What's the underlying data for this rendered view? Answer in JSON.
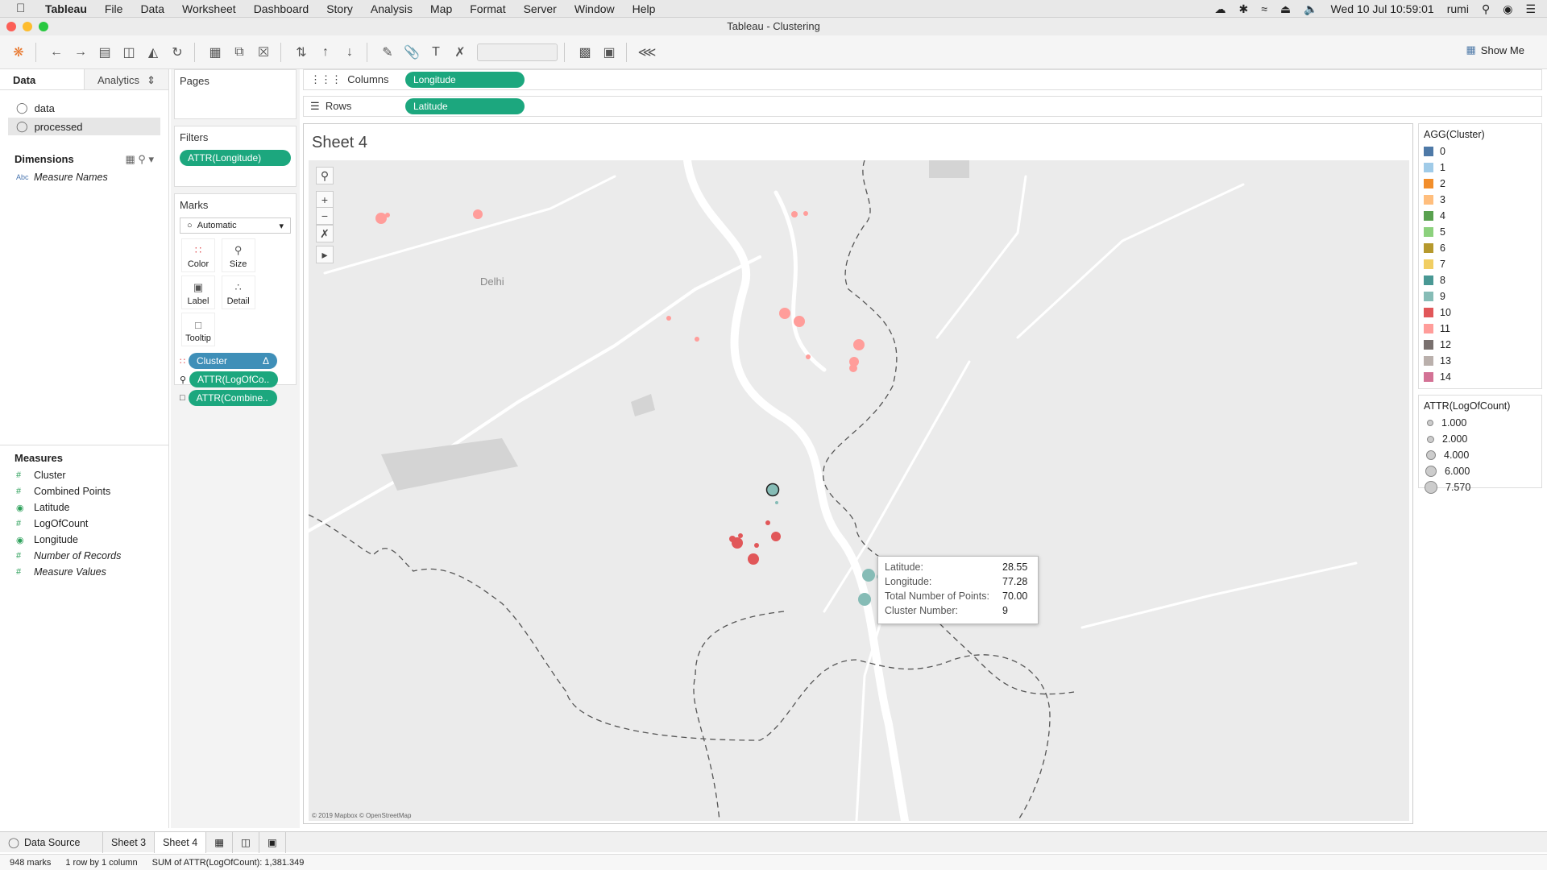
{
  "macmenu": {
    "app": "Tableau",
    "items": [
      "File",
      "Data",
      "Worksheet",
      "Dashboard",
      "Story",
      "Analysis",
      "Map",
      "Format",
      "Server",
      "Window",
      "Help"
    ],
    "clock": "Wed 10 Jul  10:59:01",
    "user": "rumi"
  },
  "window": {
    "title": "Tableau - Clustering"
  },
  "toolbar": {
    "show_me": "Show Me"
  },
  "left": {
    "tabs": [
      "Data",
      "Analytics"
    ],
    "sources": [
      "data",
      "processed"
    ],
    "dimensions_header": "Dimensions",
    "dimensions": [
      "Measure Names"
    ],
    "measures_header": "Measures",
    "measures": [
      "Cluster",
      "Combined Points",
      "Latitude",
      "LogOfCount",
      "Longitude",
      "Number of Records",
      "Measure Values"
    ]
  },
  "pages": {
    "title": "Pages"
  },
  "filters": {
    "title": "Filters",
    "items": [
      "ATTR(Longitude)"
    ]
  },
  "marks": {
    "title": "Marks",
    "type": "Automatic",
    "buttons": [
      "Color",
      "Size",
      "Label",
      "Detail",
      "Tooltip"
    ],
    "pills": [
      "Cluster",
      "ATTR(LogOfCo..",
      "ATTR(Combine.."
    ]
  },
  "shelves": {
    "columns_label": "Columns",
    "columns_pill": "Longitude",
    "rows_label": "Rows",
    "rows_pill": "Latitude"
  },
  "sheet": {
    "title": "Sheet 4",
    "city_label": "Delhi",
    "copyright": "© 2019 Mapbox © OpenStreetMap"
  },
  "tooltip": {
    "rows": [
      {
        "k": "Latitude:",
        "v": "28.55"
      },
      {
        "k": "Longitude:",
        "v": "77.28"
      },
      {
        "k": "Total Number of Points:",
        "v": "70.00"
      },
      {
        "k": "Cluster Number:",
        "v": "9"
      }
    ]
  },
  "legend_cluster": {
    "title": "AGG(Cluster)",
    "items": [
      {
        "label": "0",
        "color": "#4e79a7"
      },
      {
        "label": "1",
        "color": "#a0cbe8"
      },
      {
        "label": "2",
        "color": "#f28e2b"
      },
      {
        "label": "3",
        "color": "#ffbe7d"
      },
      {
        "label": "4",
        "color": "#59a14f"
      },
      {
        "label": "5",
        "color": "#8cd17d"
      },
      {
        "label": "6",
        "color": "#b6992d"
      },
      {
        "label": "7",
        "color": "#f1ce63"
      },
      {
        "label": "8",
        "color": "#499894"
      },
      {
        "label": "9",
        "color": "#86bcb6"
      },
      {
        "label": "10",
        "color": "#e15759"
      },
      {
        "label": "11",
        "color": "#ff9d9a"
      },
      {
        "label": "12",
        "color": "#79706e"
      },
      {
        "label": "13",
        "color": "#bab0ac"
      },
      {
        "label": "14",
        "color": "#d37295"
      }
    ]
  },
  "legend_size": {
    "title": "ATTR(LogOfCount)",
    "items": [
      "1.000",
      "2.000",
      "4.000",
      "6.000",
      "7.570"
    ]
  },
  "bottom_tabs": {
    "data_source": "Data Source",
    "sheets": [
      "Sheet 3",
      "Sheet 4"
    ]
  },
  "status": {
    "marks": "948 marks",
    "dims": "1 row by 1 column",
    "sum": "SUM of ATTR(LogOfCount): 1,381.349"
  }
}
